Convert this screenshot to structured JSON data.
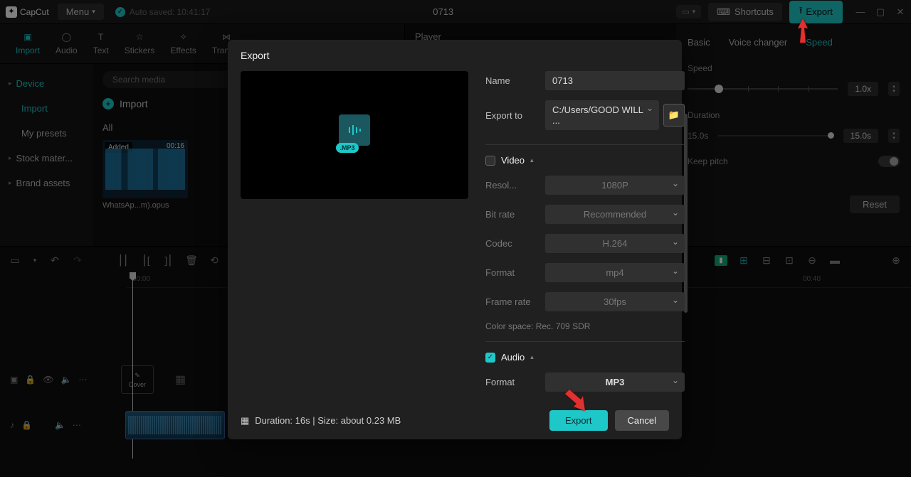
{
  "app": {
    "name": "CapCut"
  },
  "titlebar": {
    "menu": "Menu",
    "autosave": "Auto saved: 10:41:17",
    "project_title": "0713",
    "shortcuts": "Shortcuts",
    "export": "Export"
  },
  "media_tabs": {
    "import": "Import",
    "audio": "Audio",
    "text": "Text",
    "stickers": "Stickers",
    "effects": "Effects",
    "transitions": "Trans..."
  },
  "source_sidebar": {
    "device": "Device",
    "import": "Import",
    "my_presets": "My presets",
    "stock": "Stock mater...",
    "brand": "Brand assets"
  },
  "media": {
    "search_placeholder": "Search media",
    "import_btn": "Import",
    "all": "All",
    "thumb_added": "Added",
    "thumb_dur": "00:16",
    "thumb_name": "WhatsAp...m).opus"
  },
  "player": {
    "label": "Player"
  },
  "inspector": {
    "tab_basic": "Basic",
    "tab_voice": "Voice changer",
    "tab_speed": "Speed",
    "speed_label": "Speed",
    "speed_value": "1.0x",
    "duration_label": "Duration",
    "duration_val": "15.0s",
    "duration_total": "15.0s",
    "keep_pitch": "Keep pitch",
    "reset": "Reset"
  },
  "timeline": {
    "cover": "Cover",
    "ruler": {
      "t0": "00:00",
      "t1": "00:40"
    }
  },
  "modal": {
    "title": "Export",
    "name_label": "Name",
    "name_value": "0713",
    "exportto_label": "Export to",
    "exportto_value": "C:/Users/GOOD WILL ...",
    "video_section": "Video",
    "resol_label": "Resol...",
    "resol_value": "1080P",
    "bitrate_label": "Bit rate",
    "bitrate_value": "Recommended",
    "codec_label": "Codec",
    "codec_value": "H.264",
    "vformat_label": "Format",
    "vformat_value": "mp4",
    "fps_label": "Frame rate",
    "fps_value": "30fps",
    "colorspace": "Color space: Rec. 709 SDR",
    "audio_section": "Audio",
    "aformat_label": "Format",
    "aformat_value": "MP3",
    "preview_badge": ".MP3",
    "footer_info": "Duration: 16s | Size: about 0.23 MB",
    "export_btn": "Export",
    "cancel_btn": "Cancel"
  }
}
